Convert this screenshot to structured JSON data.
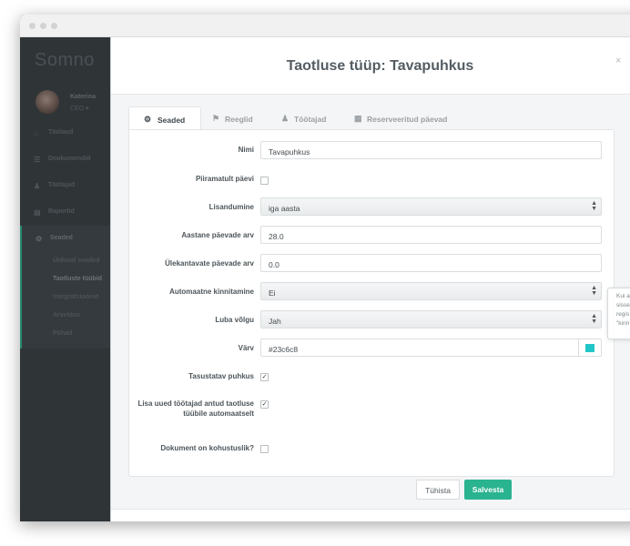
{
  "sidebar": {
    "brand": "Somno",
    "user": {
      "name": "Katerina",
      "role": "CEO ▾"
    },
    "nav": [
      {
        "label": "Töölaud",
        "icon": "⌂"
      },
      {
        "label": "Dookumendid",
        "icon": "☰"
      },
      {
        "label": "Töötajad",
        "icon": "♟"
      },
      {
        "label": "Raportid",
        "icon": "▤"
      },
      {
        "label": "Seaded",
        "icon": "⚙"
      }
    ],
    "settings_sub": [
      "Üldised seaded",
      "Taotluste tüübid",
      "Integratsioonid",
      "Arveldus",
      "Pühad"
    ]
  },
  "modal": {
    "title": "Taotluse tüüp: Tavapuhkus",
    "close": "×",
    "tabs": [
      {
        "label": "Seaded",
        "icon": "⚙"
      },
      {
        "label": "Reeglid",
        "icon": "⚑"
      },
      {
        "label": "Töötajad",
        "icon": "♟"
      },
      {
        "label": "Reserveeritud päevad",
        "icon": "▦"
      }
    ],
    "form": {
      "name": {
        "label": "Nimi",
        "value": "Tavapuhkus"
      },
      "unlimited": {
        "label": "Piiramatult päevi",
        "checked": false
      },
      "accrual": {
        "label": "Lisandumine",
        "value": "iga aasta"
      },
      "annual_days": {
        "label": "Aastane päevade arv",
        "value": "28.0"
      },
      "carryover": {
        "label": "Ülekantavate päevade arv",
        "value": "0.0"
      },
      "auto_approve": {
        "label": "Automaatne kinnitamine",
        "value": "Ei"
      },
      "allow_debt": {
        "label": "Luba võlgu",
        "value": "Jah"
      },
      "color": {
        "label": "Värv",
        "value": "#23c6c8",
        "swatch": "#23c6c8"
      },
      "paid": {
        "label": "Tasustatav puhkus",
        "checked": true,
        "mark": "✓"
      },
      "auto_add": {
        "label": "Lisa uued töötajad antud taotluse tüübile automaatselt",
        "checked": true,
        "mark": "✓"
      },
      "doc_required": {
        "label": "Dokument on kohustuslik?",
        "checked": false
      }
    },
    "tooltip": [
      "Kui a",
      "sisse",
      "regis",
      "\"kinn"
    ],
    "footer": {
      "cancel": "Tühista",
      "save": "Salvesta"
    }
  },
  "colors": {
    "accent": "#2ab38f",
    "sidebar": "#2f3437"
  }
}
